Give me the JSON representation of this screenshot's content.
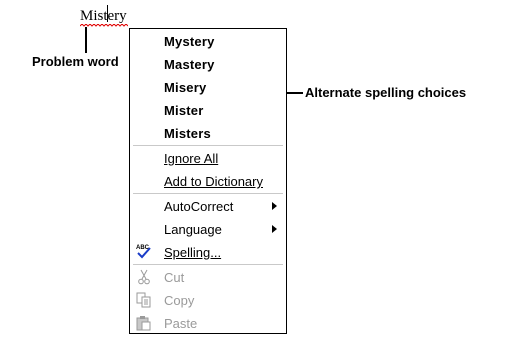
{
  "document": {
    "misspelled_word": "Mistery"
  },
  "callouts": {
    "problem_word": "Problem word",
    "alternate_spelling": "Alternate spelling choices"
  },
  "context_menu": {
    "suggestions": [
      "Mystery",
      "Mastery",
      "Misery",
      "Mister",
      "Misters"
    ],
    "ignore_all": "Ignore All",
    "add_to_dictionary": "Add to Dictionary",
    "autocorrect": "AutoCorrect",
    "language": "Language",
    "spelling": "Spelling...",
    "cut": "Cut",
    "copy": "Copy",
    "paste": "Paste"
  },
  "icons": {
    "spelling": "spelling-check-icon",
    "cut": "scissors-icon",
    "copy": "copy-icon",
    "paste": "clipboard-icon",
    "submenu": "submenu-arrow-icon"
  },
  "colors": {
    "squiggle": "#e00000",
    "disabled_text": "#9a9a9a",
    "spell_check": "#1a3cc8"
  }
}
